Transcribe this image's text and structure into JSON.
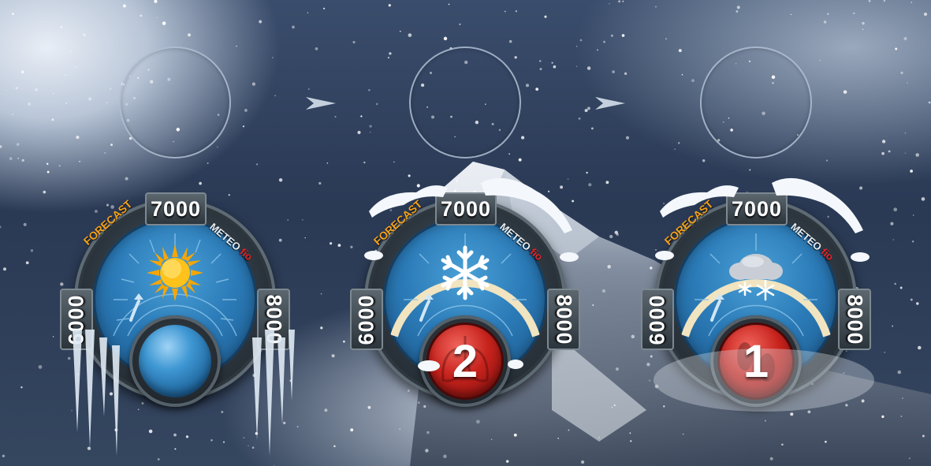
{
  "dials": [
    {
      "label_forecast": "FORECAST",
      "label_meteo": "METEO",
      "label_brand": "fio",
      "altitude_top": "7000",
      "altitude_left": "6000",
      "altitude_right": "8000",
      "weather_icon": "sun-icon",
      "knob_icon": "blank-knob",
      "knob_number": "",
      "snow_level": 0
    },
    {
      "label_forecast": "FORECAST",
      "label_meteo": "METEO",
      "label_brand": "fio",
      "altitude_top": "7000",
      "altitude_left": "6000",
      "altitude_right": "8000",
      "weather_icon": "snowflake-icon",
      "knob_icon": "lungs-icon",
      "knob_number": "2",
      "snow_level": 1
    },
    {
      "label_forecast": "FORECAST",
      "label_meteo": "METEO",
      "label_brand": "fio",
      "altitude_top": "7000",
      "altitude_left": "6000",
      "altitude_right": "8000",
      "weather_icon": "snow-cloud-icon",
      "knob_icon": "footprints-icon",
      "knob_number": "1",
      "snow_level": 1
    }
  ],
  "colors": {
    "forecast": "#f4a21a",
    "brand": "#e3262a",
    "face": "#2b7bb8",
    "knob_red": "#c7231d",
    "knob_blue": "#3e97d3"
  }
}
